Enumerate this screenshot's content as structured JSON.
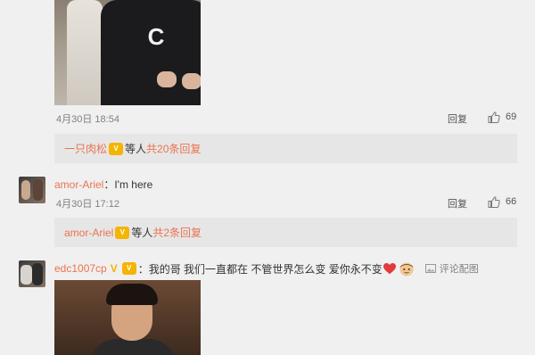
{
  "comments": [
    {
      "time": "4月30日 18:54",
      "reply_label": "回复",
      "likes": "69",
      "subreply": {
        "user": "一只肉松",
        "suffix": "等人",
        "total": "共20条回复"
      }
    },
    {
      "user": "amor-Ariel",
      "text": "：I'm here",
      "time": "4月30日 17:12",
      "reply_label": "回复",
      "likes": "66",
      "subreply": {
        "user": "amor-Ariel",
        "suffix": "等人",
        "total": "共2条回复"
      }
    },
    {
      "user": "edc1007cp",
      "text": "：我的哥 我们一直都在 不管世界怎么变 爱你永不变",
      "comment_pic_label": "评论配图"
    }
  ],
  "photo_top": {
    "jacket_letter": "C"
  },
  "colors": {
    "accent": "#eb7350",
    "bar_bg": "#e6e6e6",
    "page_bg": "#f0f0f0"
  }
}
